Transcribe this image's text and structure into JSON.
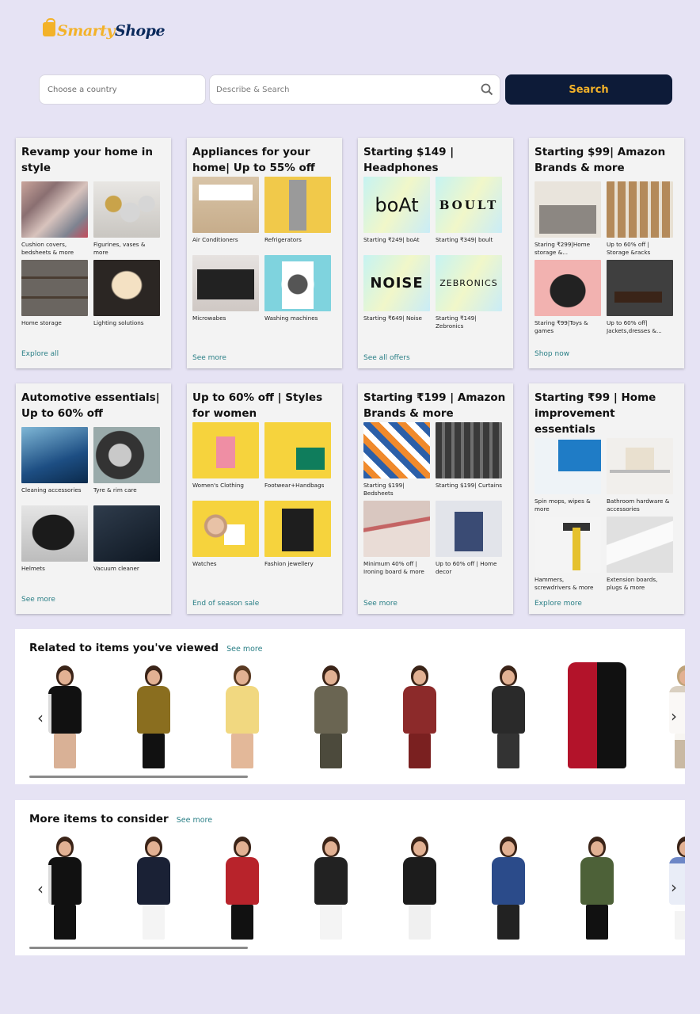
{
  "brand": {
    "name_part1": "Smarty",
    "name_part2": "Shope"
  },
  "search": {
    "country_placeholder": "Choose a country",
    "query_placeholder": "Describe & Search",
    "button_label": "Search"
  },
  "cards": [
    {
      "title": "Revamp your home in style",
      "link": "Explore all",
      "tiles": [
        {
          "caption": "Cushion covers, bedsheets & more"
        },
        {
          "caption": "Figurines, vases & more"
        },
        {
          "caption": "Home storage"
        },
        {
          "caption": "Lighting solutions"
        }
      ]
    },
    {
      "title": "Appliances for your home| Up to 55% off",
      "link": "See more",
      "tiles": [
        {
          "caption": "Air Conditioners"
        },
        {
          "caption": "Refrigerators"
        },
        {
          "caption": "Microwabes"
        },
        {
          "caption": "Washing machines"
        }
      ]
    },
    {
      "title": "Starting $149 | Headphones",
      "link": "See all offers",
      "tiles": [
        {
          "caption": "Starting ₹249| boAt",
          "brand": "boAt"
        },
        {
          "caption": "Starting ₹349| boult",
          "brand": "BOULT"
        },
        {
          "caption": "Starting ₹649| Noise",
          "brand": "NOISE"
        },
        {
          "caption": "Starting ₹149| Zebronics",
          "brand": "ZEBRONICS"
        }
      ]
    },
    {
      "title": "Starting $99| Amazon Brands & more",
      "link": "Shop now",
      "tiles": [
        {
          "caption": "Staring ₹299|Home storage &..."
        },
        {
          "caption": "Up to 60% off | Storage &racks"
        },
        {
          "caption": "Staring ₹99|Toys & games"
        },
        {
          "caption": "Up to 60% off| Jackets,dresses &..."
        }
      ]
    },
    {
      "title": "Automotive essentials| Up to 60% off",
      "link": "See more",
      "tiles": [
        {
          "caption": "Cleaning accessories"
        },
        {
          "caption": "Tyre & rim care"
        },
        {
          "caption": "Helmets"
        },
        {
          "caption": "Vacuum cleaner"
        }
      ]
    },
    {
      "title": "Up to 60% off | Styles for women",
      "link": "End of season sale",
      "tiles": [
        {
          "caption": "Women's Clothing"
        },
        {
          "caption": "Footwear+Handbags"
        },
        {
          "caption": "Watches"
        },
        {
          "caption": "Fashion jewellery"
        }
      ]
    },
    {
      "title": "Starting ₹199 | Amazon Brands & more",
      "link": "See more",
      "tiles": [
        {
          "caption": "Starting $199| Bedsheets"
        },
        {
          "caption": "Starting $199| Curtains"
        },
        {
          "caption": "Minimum 40% off | Ironing board & more"
        },
        {
          "caption": "Up to 60% off | Home decor"
        }
      ]
    },
    {
      "title": "Starting ₹99 | Home improvement essentials",
      "link": "Explore more",
      "tiles": [
        {
          "caption": "Spin mops, wipes & more"
        },
        {
          "caption": "Bathroom hardware & accessories"
        },
        {
          "caption": "Hammers, screwdrivers & more"
        },
        {
          "caption": "Extension boards, plugs & more"
        }
      ]
    }
  ],
  "strips": [
    {
      "title": "Related to items you've viewed",
      "link": "See more",
      "product_count": 8
    },
    {
      "title": "More items to consider",
      "link": "See more",
      "product_count": 8
    }
  ],
  "colors": {
    "accent": "#f3b229",
    "dark": "#0d1b38",
    "link": "#2a7f86",
    "background": "#e6e3f4"
  }
}
